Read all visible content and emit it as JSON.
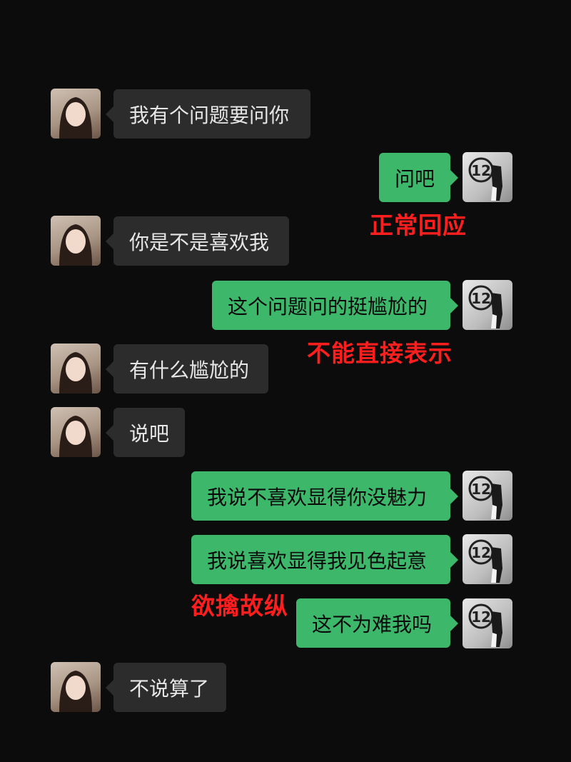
{
  "colors": {
    "background": "#0c0c0c",
    "incoming_bubble": "#2c2c2c",
    "outgoing_bubble": "#3db86a",
    "annotation": "#ff1e1e"
  },
  "messages": [
    {
      "sender": "her",
      "text": "我有个问题要问你"
    },
    {
      "sender": "me",
      "text": "问吧"
    },
    {
      "sender": "her",
      "text": "你是不是喜欢我"
    },
    {
      "sender": "me",
      "text": "这个问题问的挺尴尬的"
    },
    {
      "sender": "her",
      "text": "有什么尴尬的"
    },
    {
      "sender": "her",
      "text": "说吧"
    },
    {
      "sender": "me",
      "text": "我说不喜欢显得你没魅力"
    },
    {
      "sender": "me",
      "text": "我说喜欢显得我见色起意"
    },
    {
      "sender": "me",
      "text": "这不为难我吗"
    },
    {
      "sender": "her",
      "text": "不说算了"
    }
  ],
  "annotations": [
    "正常回应",
    "不能直接表示",
    "欲擒故纵"
  ],
  "avatars": {
    "her": "female-avatar",
    "me": "male-avatar",
    "me_badge": "12"
  }
}
